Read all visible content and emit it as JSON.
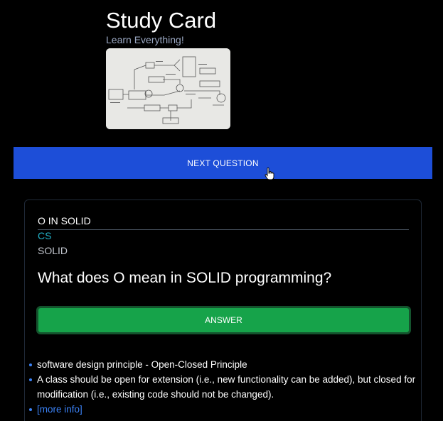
{
  "header": {
    "title": "Study Card",
    "subtitle": "Learn Everything!"
  },
  "thumbnail": {
    "icon": "diagram-image"
  },
  "next_button": {
    "label": "NEXT QUESTION"
  },
  "card": {
    "name": "O IN SOLID",
    "category": "CS",
    "subcategory": "SOLID",
    "question": "What does O mean in SOLID programming?",
    "answer_button": "ANSWER",
    "answers": [
      "software design principle - Open-Closed Principle",
      "A class should be open for extension (i.e., new functionality can be added), but closed for modification (i.e., existing code should not be changed)."
    ],
    "more_info": "[more info]"
  },
  "colors": {
    "background": "#000000",
    "next_button": "#1d4ed8",
    "answer_button": "#16a34a",
    "category": "#22b3c9",
    "bullet_link": "#3b82f6"
  }
}
